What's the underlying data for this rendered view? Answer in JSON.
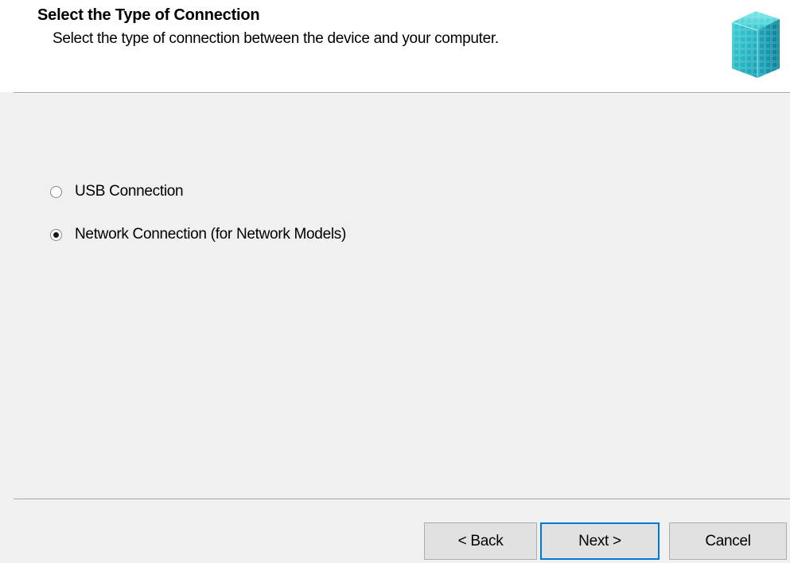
{
  "header": {
    "title": "Select the Type of Connection",
    "subtitle": "Select the type of connection between the device and your computer.",
    "icon": "setup-cubes-icon"
  },
  "options": [
    {
      "label": "USB Connection",
      "checked": false
    },
    {
      "label": "Network Connection (for Network Models)",
      "checked": true
    }
  ],
  "buttons": {
    "back": "< Back",
    "next": "Next >",
    "cancel": "Cancel"
  },
  "colors": {
    "header_bg": "#ffffff",
    "body_bg": "#f0f0f0",
    "focus_border": "#0078d7",
    "icon_accent": "#22c3c9"
  }
}
